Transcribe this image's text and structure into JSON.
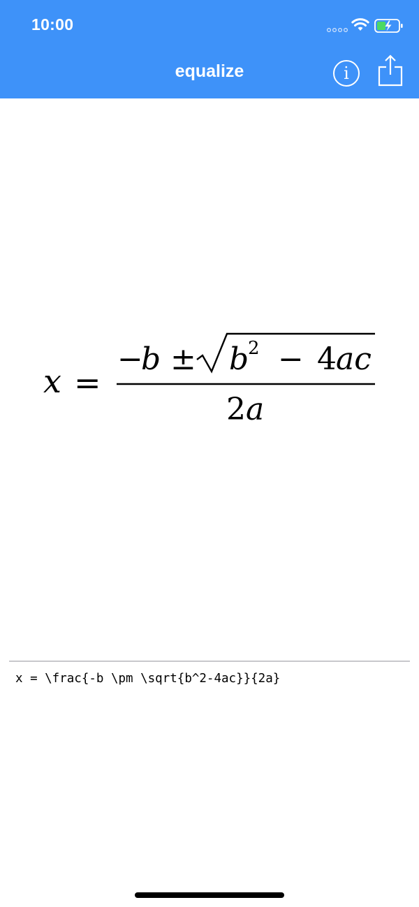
{
  "status_bar": {
    "time": "10:00"
  },
  "nav": {
    "title": "equalize"
  },
  "formula": {
    "lhs": "x",
    "equals": "=",
    "num_minus": "−",
    "num_b": "b",
    "num_pm": "±",
    "rad_b": "b",
    "rad_exp": "2",
    "rad_minus": "−",
    "rad_4": "4",
    "rad_ac": "ac",
    "den_2": "2",
    "den_a": "a"
  },
  "editor": {
    "latex": "x = \\frac{-b \\pm \\sqrt{b^2-4ac}}{2a}"
  }
}
